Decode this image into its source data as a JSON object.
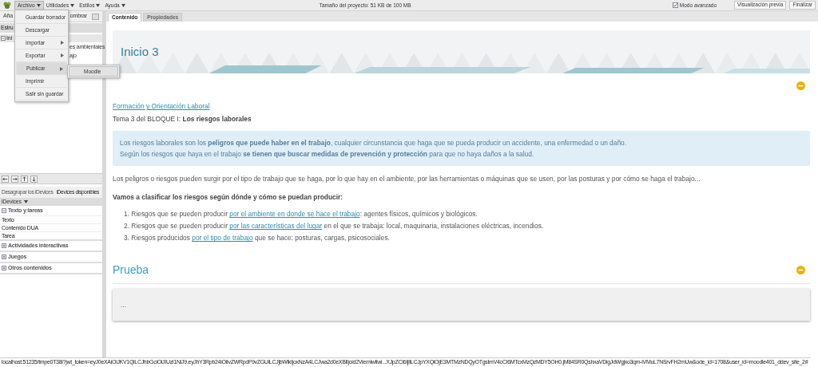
{
  "menubar": {
    "menus": [
      {
        "label": "Archivo",
        "open": true
      },
      {
        "label": "Utilidades",
        "open": false
      },
      {
        "label": "Estilos",
        "open": false
      },
      {
        "label": "Ayuda",
        "open": false
      }
    ],
    "project_size": "Tamaño del proyecto: 51 KB de 100 MB",
    "advanced_mode": {
      "label": "Modo avanzado",
      "checked": true
    },
    "buttons": [
      "Visualización previa",
      "Finalizar"
    ]
  },
  "file_menu": {
    "items": [
      {
        "label": "Guardar borrador",
        "kind": "item",
        "highlighted": false
      },
      {
        "label": "Descargar",
        "kind": "item",
        "highlighted": false
      },
      {
        "label": "Importar",
        "kind": "submenu",
        "highlighted": false
      },
      {
        "label": "Exportar",
        "kind": "submenu",
        "highlighted": false
      },
      {
        "label": "Publicar",
        "kind": "submenu",
        "highlighted": true
      },
      {
        "label": "Imprimir",
        "kind": "item",
        "highlighted": false
      },
      {
        "label": "Salir sin guardar",
        "kind": "item",
        "highlighted": false
      }
    ],
    "submenu": [
      "Moodle"
    ]
  },
  "left_panel": {
    "toolbar": [
      "Aña",
      "ombrar"
    ],
    "structure_title": "Estru",
    "tree": [
      {
        "label": "Ini",
        "expanded": true,
        "children": [
          {
            "label": "es ambientales"
          },
          {
            "label": "ajo"
          }
        ]
      }
    ],
    "tabs": [
      {
        "label": "Desagrupar los iDevices",
        "selected": false
      },
      {
        "label": "iDevices disponibles",
        "selected": true
      }
    ],
    "idevices_title": "iDevices",
    "categories": [
      {
        "label": "Texto y tareas",
        "expanded": true,
        "items": [
          "Texto",
          "Contenido DUA",
          "Tarea"
        ]
      },
      {
        "label": "Actividades interactivas",
        "expanded": false
      },
      {
        "label": "Juegos",
        "expanded": false
      },
      {
        "label": "Otros contenidos",
        "expanded": false
      }
    ]
  },
  "content_tabs": [
    {
      "label": "Contenido",
      "selected": true
    },
    {
      "label": "Propiedades",
      "selected": false
    }
  ],
  "page_title": "Inicio 3",
  "intro": {
    "link": "Formación y Orientación Laboral",
    "subtitle": "Tema 3 del BLOQUE I: **Los  riesgos laborales**"
  },
  "info_box": [
    "Los riesgos laborales son los **peligros que puede haber en el trabajo**, cualquier circunstancia que haga que se pueda producir un accidente, una enfermedad o un daño.",
    "Según los riesgos que haya en el trabajo **se tienen que buscar medidas de prevención y protección** para que no haya daños a la salud."
  ],
  "paragraph": "Los peligros o riesgos pueden surgir por el tipo de trabajo que se haga, por lo que hay en el ambiente, por las herramientas o máquinas que se usen, por las posturas y por cómo se haga el trabajo...",
  "list_heading": "Vamos a clasificar los riesgos según dónde y cómo se puedan producir:",
  "list": [
    {
      "number": "1.",
      "before": "Riesgos que se pueden producir ",
      "link": "por el ambiente en donde se hace el trabajo",
      "after": ": agentes físicos, químicos y biológicos."
    },
    {
      "number": "2.",
      "before": "Riesgos que se pueden producir ",
      "link": "por las características del lugar",
      "after": " en el que se trabaja: local, maquinaria, instalaciones eléctricas, incendios."
    },
    {
      "number": "3.",
      "before": "Riesgos producidos ",
      "link": "por el tipo de trabajo",
      "after": " que se hace: posturas, cargas, psicosociales."
    }
  ],
  "second_block": {
    "title": "Prueba",
    "body": "..."
  },
  "status_url": "localhost:51235/tmpe0T38i?jwt_token=eyJ0eXAiOiJKV1QiLCJhbGciOiJIUzI1NiJ9.eyJhY3Rpb24iOiIvZWRpdF9vZGUiLCJjbWlkIjoxNzA4LCJwa2d0eXBlIjoid2ViemlwIiwi...XJpZCI6IjliLCJpYXQiOjE3MTMzNDQyOTgsImV4cCI6MTcxMzQzMDY5OH0.jM84SR0QshxaVDigJdWgjxo3qm-iVMuL7NSrvFH2mUw&ode_id=1708&user_id=moodle401_ddev_site_2#"
}
